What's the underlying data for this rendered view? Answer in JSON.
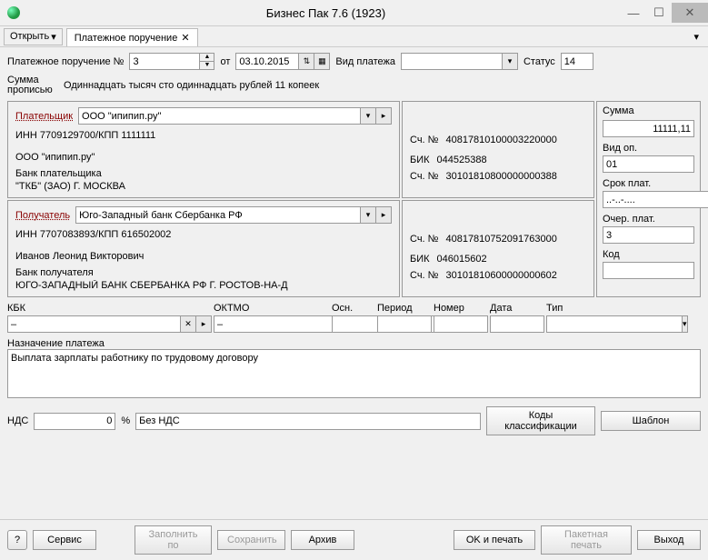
{
  "window": {
    "title": "Бизнес Пак 7.6 (1923)"
  },
  "toolbar": {
    "open": "Открыть",
    "tab_label": "Платежное поручение"
  },
  "header": {
    "doc_label": "Платежное поручение №",
    "doc_num": "3",
    "ot": "от",
    "date": "03.10.2015",
    "vid_label": "Вид платежа",
    "vid_value": "",
    "status_label": "Статус",
    "status_value": "14",
    "summa_label": "Сумма прописью",
    "summa_text": "Одиннадцать тысяч сто одиннадцать рублей 11 копеек"
  },
  "payer": {
    "label": "Плательщик",
    "company": "ООО \"ипипип.ру\"",
    "inn_kpp": "ИНН 7709129700/КПП 1111111",
    "name": "ООО \"ипипип.ру\"",
    "bank_label": "Банк плательщика",
    "bank_name": "\"ТКБ\" (ЗАО) Г. МОСКВА",
    "sch_label": "Сч. №",
    "sch": "40817810100003220000",
    "bik_label": "БИК",
    "bik": "044525388",
    "korr": "30101810800000000388"
  },
  "payee": {
    "label": "Получатель",
    "company": "Юго-Западный банк Сбербанка РФ",
    "inn_kpp": "ИНН 7707083893/КПП 616502002",
    "name": "Иванов Леонид Викторович",
    "bank_label": "Банк получателя",
    "bank_name": "ЮГО-ЗАПАДНЫЙ БАНК СБЕРБАНКА РФ Г. РОСТОВ-НА-Д",
    "sch": "40817810752091763000",
    "bik": "046015602",
    "korr": "30101810600000000602"
  },
  "right": {
    "summa_label": "Сумма",
    "summa": "11111,11",
    "vid_op_label": "Вид оп.",
    "vid_op": "01",
    "srok_label": "Срок плат.",
    "srok": "..-..-....",
    "ocher_label": "Очер.  плат.",
    "ocher": "3",
    "kod_label": "Код",
    "kod": ""
  },
  "kbk": {
    "kbk_label": "КБК",
    "oktmo_label": "ОКТМО",
    "osn_label": "Осн.",
    "period_label": "Период",
    "nomer_label": "Номер",
    "data_label": "Дата",
    "tip_label": "Тип",
    "kbk_val": "–",
    "oktmo_val": "–"
  },
  "purpose": {
    "label": "Назначение платежа",
    "text": "Выплата зарплаты работнику по трудовому договору"
  },
  "nds": {
    "label": "НДС",
    "percent": "0",
    "pct_sign": "%",
    "text": "Без НДС",
    "btn_classif": "Коды классификации",
    "btn_tpl": "Шаблон"
  },
  "footer": {
    "service": "Сервис",
    "fill": "Заполнить по",
    "save": "Сохранить",
    "archive": "Архив",
    "ok_print": "OK и печать",
    "batch": "Пакетная печать",
    "exit": "Выход"
  }
}
